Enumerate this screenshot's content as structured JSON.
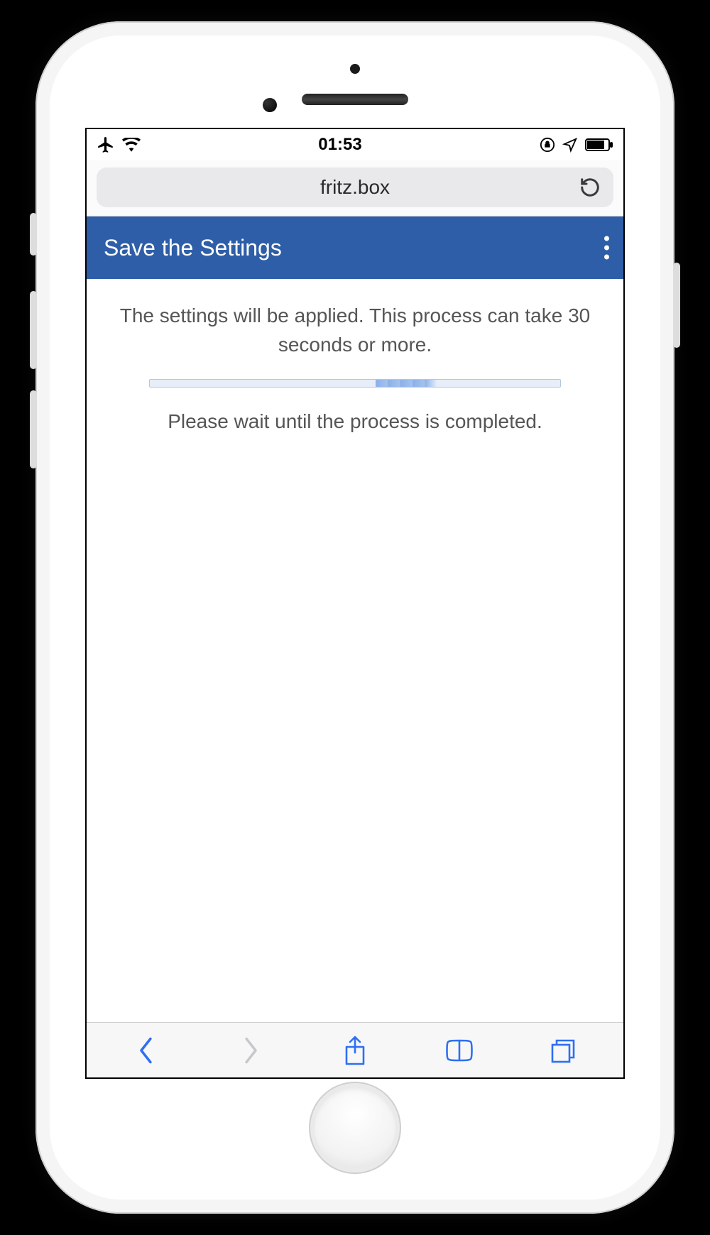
{
  "statusbar": {
    "time": "01:53"
  },
  "browser": {
    "address": "fritz.box"
  },
  "header": {
    "title": "Save the Settings"
  },
  "content": {
    "message1": "The settings will be applied. This process can take 30 seconds or more.",
    "message2": "Please wait until the process is completed."
  }
}
